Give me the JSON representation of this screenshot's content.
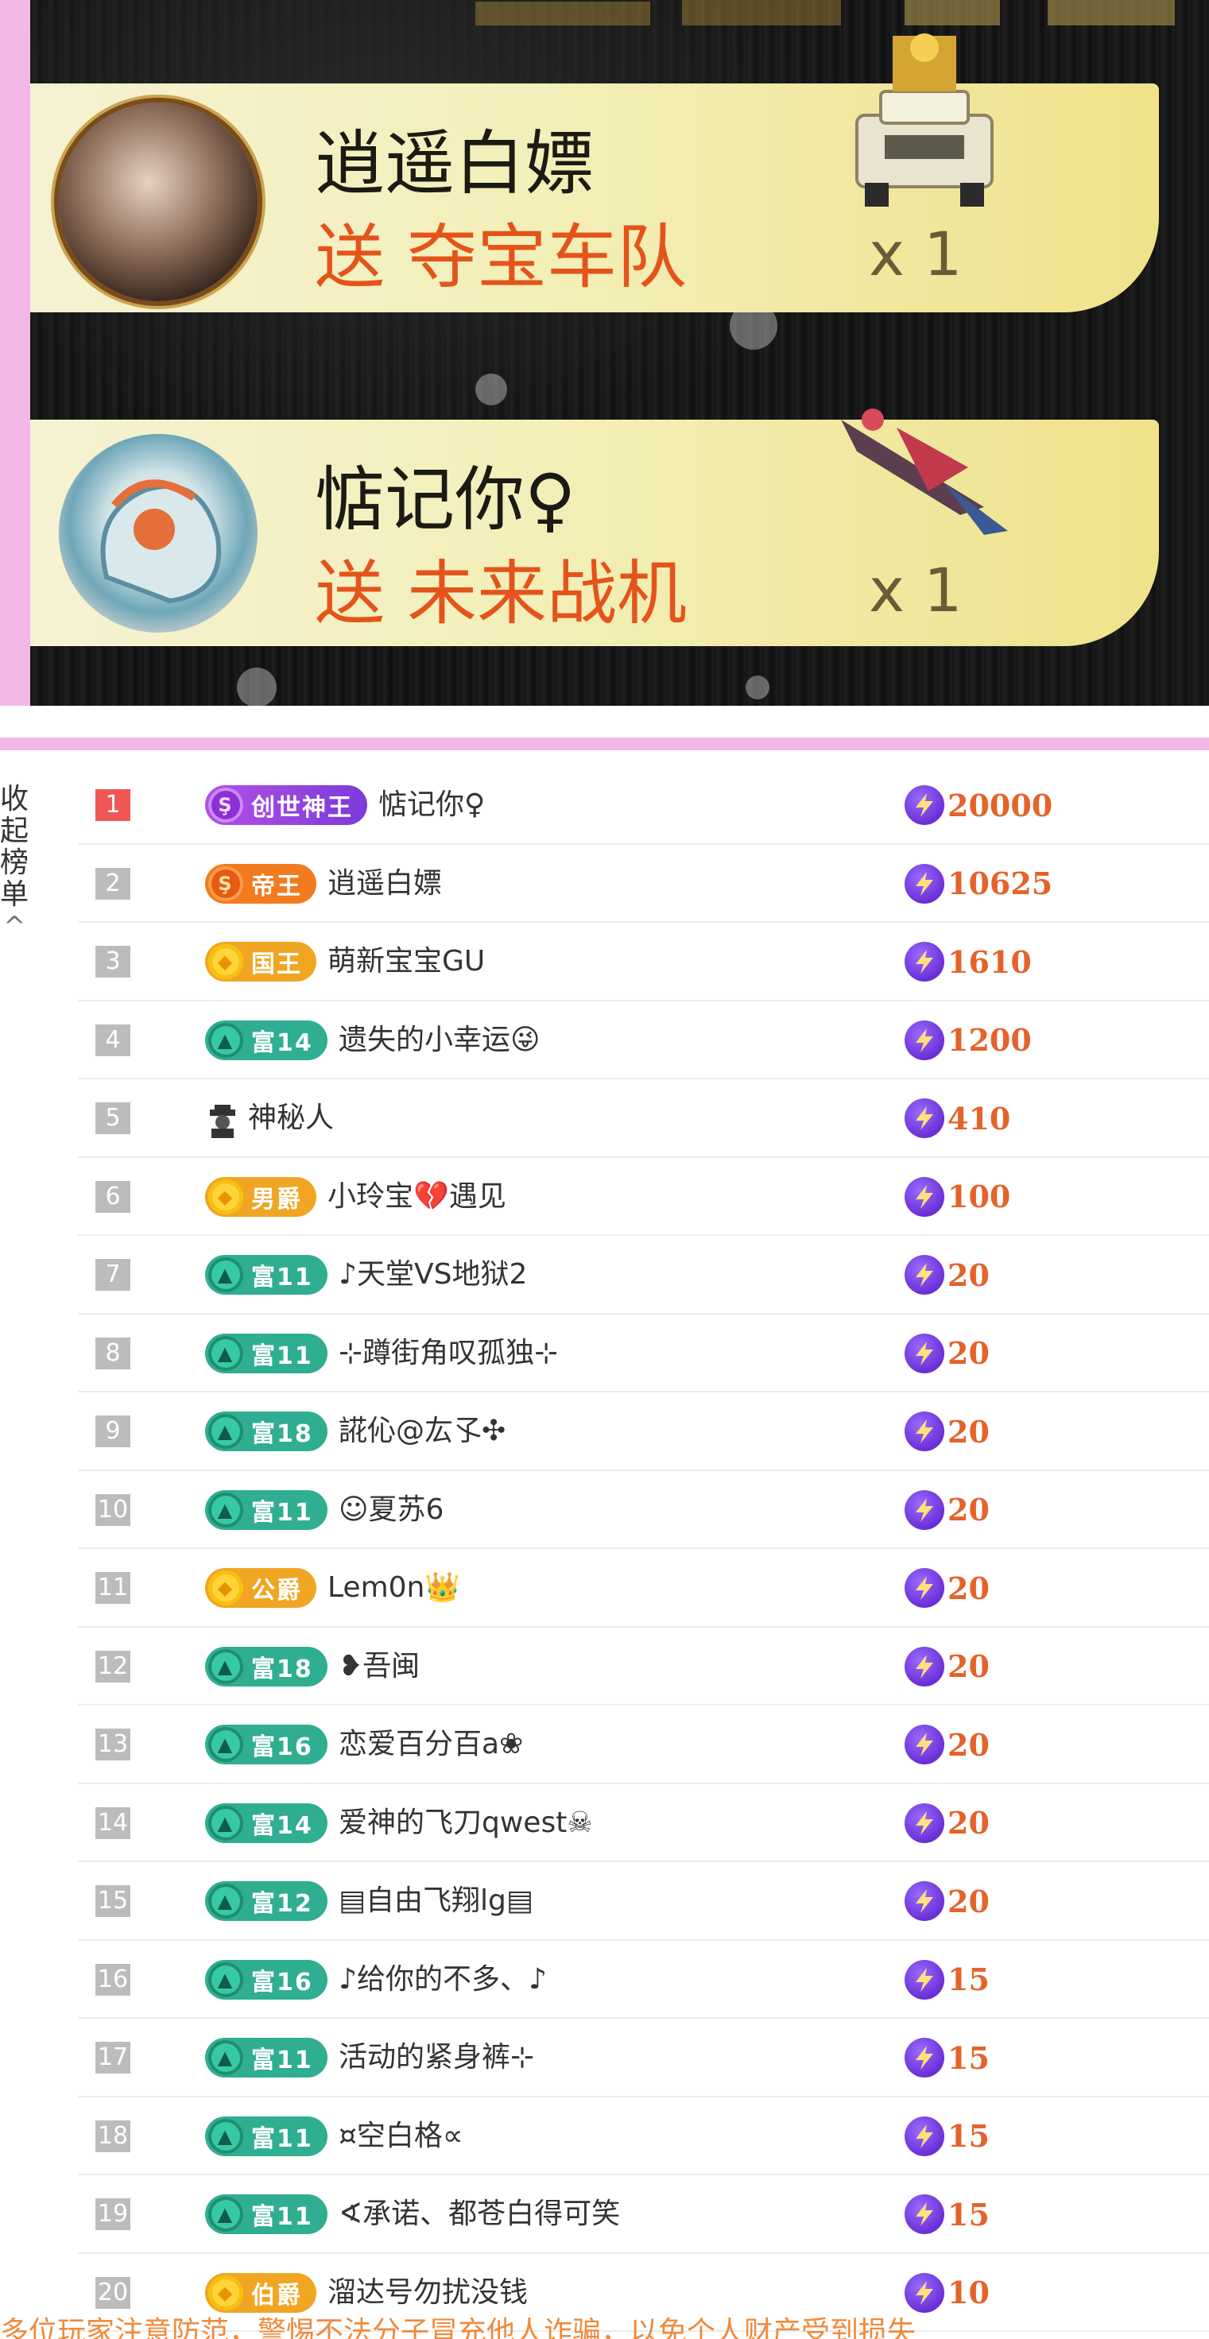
{
  "gift_feed": [
    {
      "user": "逍遥白嫖",
      "action": "送 夺宝车队",
      "count": "x 1",
      "gift_icon": "treasure-car-icon"
    },
    {
      "user": "惦记你♀",
      "action": "送 未来战机",
      "count": "x 1",
      "gift_icon": "fighter-jet-icon"
    }
  ],
  "side_toggle": {
    "label": "收起榜单",
    "icon": "chevron-up-icon"
  },
  "ranking": [
    {
      "rank": "1",
      "badge": "创世神王",
      "badge_style": "purple",
      "name": "惦记你♀",
      "points": "20000"
    },
    {
      "rank": "2",
      "badge": "帝王",
      "badge_style": "orange",
      "name": "逍遥白嫖",
      "points": "10625"
    },
    {
      "rank": "3",
      "badge": "国王",
      "badge_style": "gold",
      "name": "萌新宝宝GU",
      "points": "1610"
    },
    {
      "rank": "4",
      "badge": "富14",
      "badge_style": "green",
      "name": "遗失的小幸运😜",
      "points": "1200"
    },
    {
      "rank": "5",
      "badge": "",
      "badge_style": "spy",
      "name": "神秘人",
      "points": "410"
    },
    {
      "rank": "6",
      "badge": "男爵",
      "badge_style": "gold",
      "name": "小玲宝💔遇见",
      "points": "100"
    },
    {
      "rank": "7",
      "badge": "富11",
      "badge_style": "green",
      "name": "♪天堂VS地狱2",
      "points": "20"
    },
    {
      "rank": "8",
      "badge": "富11",
      "badge_style": "green",
      "name": "⊹蹲街角叹孤独⊹",
      "points": "20"
    },
    {
      "rank": "9",
      "badge": "富18",
      "badge_style": "green",
      "name": "誮伈@厷孓✣",
      "points": "20"
    },
    {
      "rank": "10",
      "badge": "富11",
      "badge_style": "green",
      "name": "☺夏苏6",
      "points": "20"
    },
    {
      "rank": "11",
      "badge": "公爵",
      "badge_style": "gold",
      "name": "Lem0n👑",
      "points": "20"
    },
    {
      "rank": "12",
      "badge": "富18",
      "badge_style": "green",
      "name": "❥吾闽",
      "points": "20"
    },
    {
      "rank": "13",
      "badge": "富16",
      "badge_style": "green",
      "name": "恋爱百分百a❀",
      "points": "20"
    },
    {
      "rank": "14",
      "badge": "富14",
      "badge_style": "green",
      "name": "爱神的飞刀qwest☠",
      "points": "20"
    },
    {
      "rank": "15",
      "badge": "富12",
      "badge_style": "green",
      "name": "▤自由飞翔lg▤",
      "points": "20"
    },
    {
      "rank": "16",
      "badge": "富16",
      "badge_style": "green",
      "name": "♪给你的不多、♪",
      "points": "15"
    },
    {
      "rank": "17",
      "badge": "富11",
      "badge_style": "green",
      "name": "活动的紧身裤⊹",
      "points": "15"
    },
    {
      "rank": "18",
      "badge": "富11",
      "badge_style": "green",
      "name": "¤空白格∝",
      "points": "15"
    },
    {
      "rank": "19",
      "badge": "富11",
      "badge_style": "green",
      "name": "∢承诺、都苍白得可笑",
      "points": "15"
    },
    {
      "rank": "20",
      "badge": "伯爵",
      "badge_style": "gold",
      "name": "溜达号勿扰没钱",
      "points": "10"
    }
  ],
  "footer_note": "多位玩家注意防范，警惕不法分子冒充他人诈骗，以免个人财产受到损失",
  "colors": {
    "accent_pink": "#f3b7e6",
    "points_orange": "#e4632a",
    "rank1_red": "#f05656"
  }
}
